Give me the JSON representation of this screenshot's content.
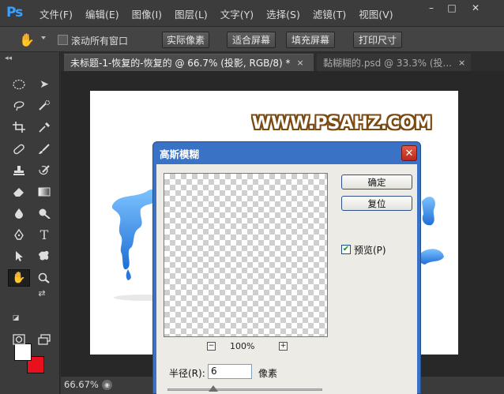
{
  "app": {
    "logo": "Ps"
  },
  "menu": [
    "文件(F)",
    "编辑(E)",
    "图像(I)",
    "图层(L)",
    "文字(Y)",
    "选择(S)",
    "滤镜(T)",
    "视图(V)"
  ],
  "window_controls": {
    "minimize": "–",
    "restore": "□",
    "close": "✕"
  },
  "options_bar": {
    "scroll_all_label": "滚动所有窗口",
    "buttons": [
      "实际像素",
      "适合屏幕",
      "填充屏幕",
      "打印尺寸"
    ]
  },
  "tabs": [
    {
      "label": "未标题-1-恢复的-恢复的 @ 66.7% (投影, RGB/8) *",
      "close": "×"
    },
    {
      "label": "黏糊糊的.psd @ 33.3% (投...",
      "close": "×"
    }
  ],
  "canvas": {
    "watermark": "WWW.PSAHZ.COM"
  },
  "status": {
    "zoom": "66.67%"
  },
  "colors": {
    "foreground": "#ffffff",
    "background": "#e8101c",
    "accent": "#3a72c6"
  },
  "dialog": {
    "title": "高斯模糊",
    "close": "✕",
    "ok_label": "确定",
    "reset_label": "复位",
    "preview_label": "预览(P)",
    "preview_checked": true,
    "zoom_minus": "−",
    "zoom_plus": "+",
    "zoom_percent": "100%",
    "radius_label": "半径(R):",
    "radius_value": "6",
    "radius_unit": "像素"
  }
}
